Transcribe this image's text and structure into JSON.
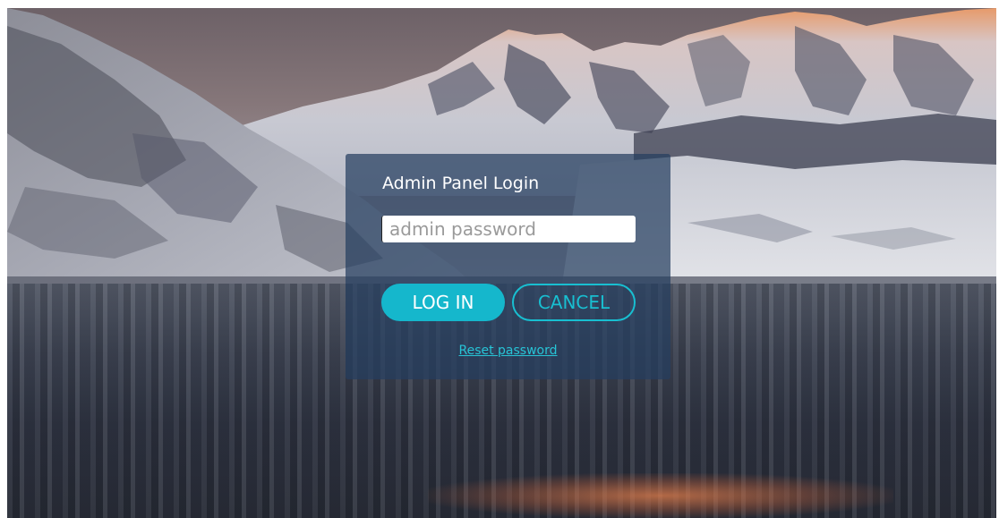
{
  "login": {
    "title": "Admin Panel Login",
    "password_placeholder": "admin password",
    "password_value": "",
    "login_label": "LOG IN",
    "cancel_label": "CANCEL",
    "reset_label": "Reset password"
  },
  "colors": {
    "accent": "#15b7cc",
    "panel": "#263e60",
    "link": "#27c4d6"
  },
  "icons": {
    "background": "mountain-lake-landscape"
  }
}
